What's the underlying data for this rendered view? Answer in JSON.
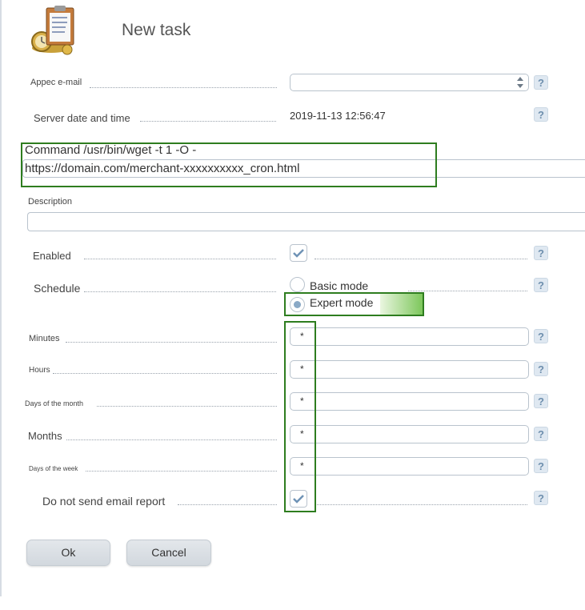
{
  "header": {
    "title": "New task",
    "logo_icon": "clipboard-clock-icon"
  },
  "form": {
    "email_label": "Appec e-mail",
    "email_value": "",
    "server_time_label": "Server date and time",
    "server_time_value": "2019-11-13 12:56:47",
    "command_label": "Command /usr/bin/wget -t 1 -O -",
    "command_value": "https://domain.com/merchant-xxxxxxxxxx_cron.html",
    "description_label": "Description",
    "description_value": "",
    "enabled_label": "Enabled",
    "enabled_checked": true,
    "schedule_label": "Schedule",
    "schedule_options": [
      "Basic mode",
      "Expert mode"
    ],
    "schedule_selected": "Expert mode",
    "minutes_label": "Minutes",
    "minutes_value": "*",
    "hours_label": "Hours",
    "hours_value": "*",
    "days_of_month_label": "Days of the month",
    "days_of_month_value": "*",
    "months_label": "Months",
    "months_value": "*",
    "days_of_week_label": "Days of the week",
    "days_of_week_value": "*",
    "no_email_label": "Do not send email report",
    "no_email_checked": true,
    "help_glyph": "?"
  },
  "buttons": {
    "ok": "Ok",
    "cancel": "Cancel"
  },
  "colors": {
    "highlight": "#2e7d1f",
    "help_bg": "#dfe8f1",
    "help_fg": "#6e8fae"
  }
}
